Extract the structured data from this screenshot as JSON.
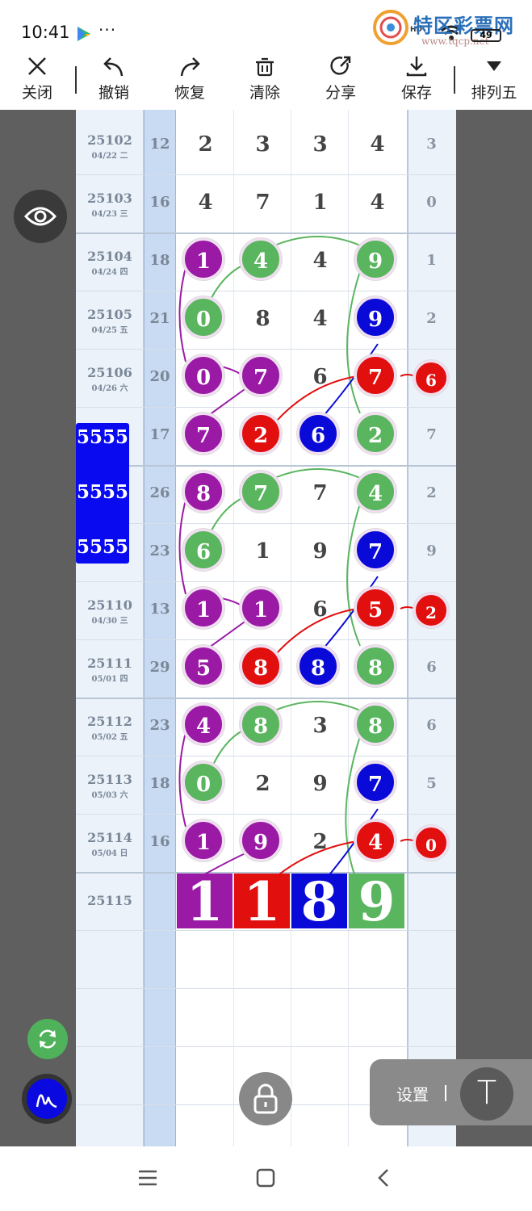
{
  "status": {
    "time": "10:41",
    "more": "···",
    "battery": "49",
    "network": "HD"
  },
  "watermark": {
    "name": "特区彩票网",
    "url": "www.tqcp.net"
  },
  "toolbar": {
    "close": "关闭",
    "undo": "撤销",
    "redo": "恢复",
    "clear": "清除",
    "share": "分享",
    "save": "保存",
    "mode": "排列五"
  },
  "colors": {
    "purple": "#9a1aa6",
    "green": "#5ab55f",
    "red": "#e20f0f",
    "blue": "#0a0ad8"
  },
  "rows": [
    {
      "period": "25102",
      "date": "04/22 二",
      "sum": "12",
      "digits": [
        "2",
        "3",
        "3",
        "4"
      ],
      "span": "3"
    },
    {
      "period": "25103",
      "date": "04/23 三",
      "sum": "16",
      "digits": [
        "4",
        "7",
        "1",
        "4"
      ],
      "span": "0"
    },
    {
      "period": "25104",
      "date": "04/24 四",
      "sum": "18",
      "digits": [
        "1",
        "4",
        "4",
        "9"
      ],
      "span": "1"
    },
    {
      "period": "25105",
      "date": "04/25 五",
      "sum": "21",
      "digits": [
        "0",
        "8",
        "4",
        "9"
      ],
      "span": "2"
    },
    {
      "period": "25106",
      "date": "04/26 六",
      "sum": "20",
      "digits": [
        "0",
        "7",
        "6",
        "7"
      ],
      "span": "6"
    },
    {
      "period": "",
      "date": "",
      "sum": "17",
      "digits": [
        "7",
        "2",
        "6",
        "2"
      ],
      "span": "7"
    },
    {
      "period": "",
      "date": "",
      "sum": "26",
      "digits": [
        "8",
        "7",
        "7",
        "4"
      ],
      "span": "2"
    },
    {
      "period": "",
      "date": "",
      "sum": "23",
      "digits": [
        "6",
        "1",
        "9",
        "7"
      ],
      "span": "9"
    },
    {
      "period": "25110",
      "date": "04/30 三",
      "sum": "13",
      "digits": [
        "1",
        "1",
        "6",
        "5"
      ],
      "span": "2"
    },
    {
      "period": "25111",
      "date": "05/01 四",
      "sum": "29",
      "digits": [
        "5",
        "8",
        "8",
        "8"
      ],
      "span": "6"
    },
    {
      "period": "25112",
      "date": "05/02 五",
      "sum": "23",
      "digits": [
        "4",
        "8",
        "3",
        "8"
      ],
      "span": "6"
    },
    {
      "period": "25113",
      "date": "05/03 六",
      "sum": "18",
      "digits": [
        "0",
        "2",
        "9",
        "7"
      ],
      "span": "5"
    },
    {
      "period": "25114",
      "date": "05/04 日",
      "sum": "16",
      "digits": [
        "1",
        "9",
        "2",
        "4"
      ],
      "span": "0"
    },
    {
      "period": "25115",
      "date": "",
      "sum": "",
      "digits": [
        "",
        "",
        "",
        ""
      ],
      "span": ""
    }
  ],
  "prediction": [
    "1",
    "1",
    "8",
    "9"
  ],
  "overlay": [
    "5555",
    "5555",
    "5555"
  ],
  "settings": {
    "label": "设置",
    "t_button": "T"
  }
}
